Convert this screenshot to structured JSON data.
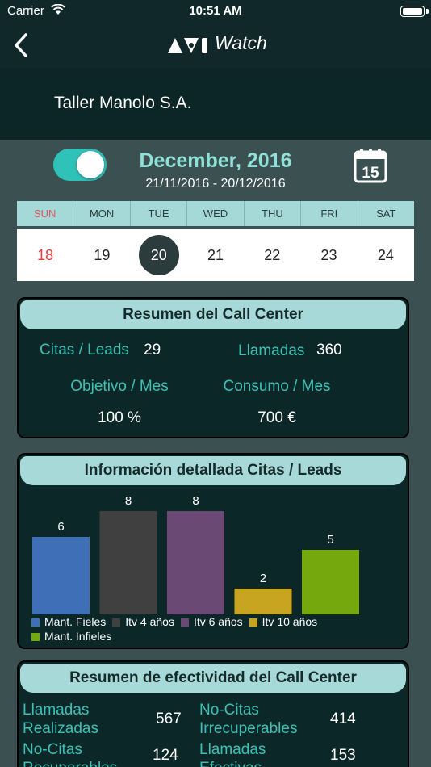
{
  "status": {
    "carrier": "Carrier",
    "time": "10:51 AM"
  },
  "nav": {
    "brand_text": "Watch"
  },
  "client": {
    "name": "Taller Manolo S.A."
  },
  "period": {
    "month_title": "December, 2016",
    "range": "21/11/2016 - 20/12/2016",
    "calendar_day": "15",
    "toggle_on": true
  },
  "week": {
    "days": [
      "SUN",
      "MON",
      "TUE",
      "WED",
      "THU",
      "FRI",
      "SAT"
    ],
    "dates": [
      "18",
      "19",
      "20",
      "21",
      "22",
      "23",
      "24"
    ],
    "selected_index": 2
  },
  "summary": {
    "title": "Resumen del Call Center",
    "citas_label": "Citas / Leads",
    "citas_value": "29",
    "llamadas_label": "Llamadas",
    "llamadas_value": "360",
    "objetivo_label": "Objetivo / Mes",
    "objetivo_value": "100 %",
    "consumo_label": "Consumo / Mes",
    "consumo_value": "700 €"
  },
  "chart": {
    "title": "Información detallada Citas / Leads"
  },
  "chart_data": {
    "type": "bar",
    "categories": [
      "Mant. Fieles",
      "Itv 4 años",
      "Itv 6 años",
      "Itv 10 años",
      "Mant. Infieles"
    ],
    "values": [
      6,
      8,
      8,
      2,
      5
    ],
    "colors": [
      "#3f6fb6",
      "#404040",
      "#6a4a74",
      "#c8a521",
      "#74a80d"
    ],
    "ylim": [
      0,
      8
    ],
    "legend_position": "bottom",
    "grid": false
  },
  "effectiveness": {
    "title": "Resumen de efectividad del Call Center",
    "rows": [
      {
        "label_1": "Llamadas",
        "label_2": "Realizadas",
        "value": "567"
      },
      {
        "label_1": "No-Citas",
        "label_2": "Irrecuperables",
        "value": "414"
      },
      {
        "label_1": "No-Citas",
        "label_2": "Recuperables",
        "value": "124"
      },
      {
        "label_1": "Llamadas",
        "label_2": "Efectivas",
        "value": "153"
      }
    ]
  },
  "colors": {
    "accent": "#3cc2b5",
    "toggle": "#2fc2b9",
    "header_bar": "#102829",
    "card_bg": "#0c2728",
    "card_header": "#a6d9d8",
    "sunday": "#e23a3f"
  },
  "icons": {
    "back": "chevron-left-icon",
    "wifi": "wifi-icon",
    "battery": "battery-icon",
    "calendar": "calendar-icon",
    "logo": "brand-logo"
  }
}
